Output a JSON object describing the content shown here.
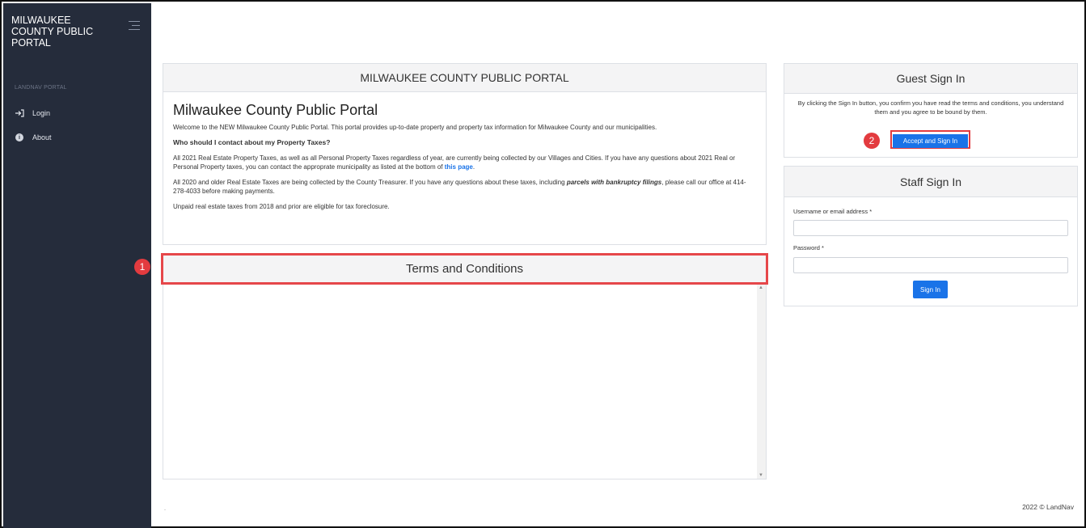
{
  "sidebar": {
    "brand": "MILWAUKEE COUNTY PUBLIC PORTAL",
    "section_label": "LANDNAV PORTAL",
    "items": [
      {
        "label": "Login",
        "icon": "login-icon"
      },
      {
        "label": "About",
        "icon": "info-icon"
      }
    ]
  },
  "main": {
    "header": "MILWAUKEE COUNTY PUBLIC PORTAL",
    "title": "Milwaukee County Public Portal",
    "welcome": "Welcome to the NEW Milwaukee County Public Portal.  This portal provides up-to-date property and property tax information for Milwaukee County and our municipalities.",
    "question": "Who should I contact about my Property Taxes?",
    "para1_pre": "All 2021 Real Estate Property Taxes, as well as all Personal Property Taxes regardless of year, are currently being collected by our Villages and Cities.  If you have any questions about 2021 Real or Personal Property taxes, you can contact the approprate municipality as listed at the bottom of ",
    "para1_link": "this page",
    "para1_post": ".",
    "para2_pre": "All 2020 and older Real Estate Taxes are being collected by the County Treasurer.  If you have any questions about these taxes, including ",
    "para2_emph": "parcels with bankruptcy filings",
    "para2_post": ", please call our office at 414-278-4033 before making payments.",
    "para3": "Unpaid real estate taxes from 2018 and prior are eligible for tax foreclosure."
  },
  "terms": {
    "header": "Terms and Conditions",
    "scroll_up": "▲",
    "scroll_down": "▼"
  },
  "guest": {
    "header": "Guest Sign In",
    "text": "By clicking the Sign In button, you confirm you have read the terms and conditions, you understand them and you agree to be bound by them.",
    "button": "Accept and Sign In"
  },
  "staff": {
    "header": "Staff Sign In",
    "username_label": "Username or email address *",
    "username_value": "",
    "password_label": "Password *",
    "password_value": "",
    "button": "Sign In"
  },
  "markers": [
    "1",
    "2"
  ],
  "footer": {
    "left": "-",
    "copyright": "2022 © LandNav"
  },
  "colors": {
    "sidebar_bg": "#252c3b",
    "accent_blue": "#1a73e8",
    "highlight_red": "#e33b3f"
  }
}
